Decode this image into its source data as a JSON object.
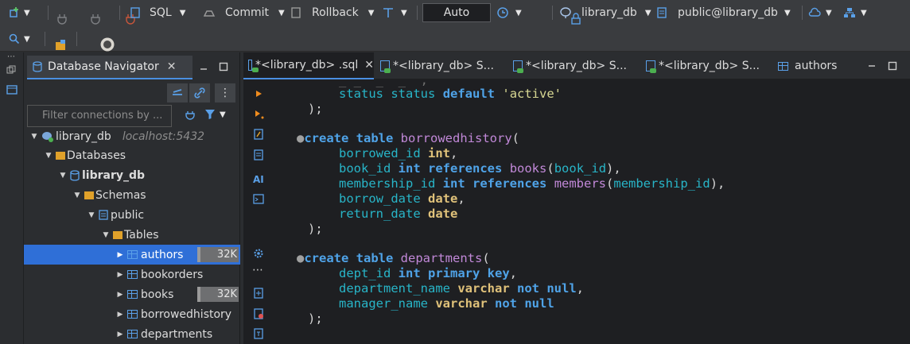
{
  "toolbar": {
    "sql_label": "SQL",
    "commit_label": "Commit",
    "rollback_label": "Rollback",
    "transaction_mode": "Auto",
    "datasource_label": "library_db",
    "schema_label": "public@library_db"
  },
  "navigator": {
    "tab_title": "Database Navigator",
    "filter_placeholder": "Filter connections by ...",
    "tree": [
      {
        "label": "library_db",
        "host": "localhost:5432"
      },
      {
        "label": "Databases"
      },
      {
        "label": "library_db"
      },
      {
        "label": "Schemas"
      },
      {
        "label": "public"
      },
      {
        "label": "Tables"
      },
      {
        "label": "authors",
        "size": "32K",
        "size_fill": 0.08
      },
      {
        "label": "bookorders"
      },
      {
        "label": "books",
        "size": "32K",
        "size_fill": 0.08
      },
      {
        "label": "borrowedhistory"
      },
      {
        "label": "departments"
      }
    ]
  },
  "editor_tabs": [
    {
      "label": "*<library_db> .sql"
    },
    {
      "label": "*<library_db> S..."
    },
    {
      "label": "*<library_db> S..."
    },
    {
      "label": "*<library_db> S..."
    },
    {
      "label": "authors"
    }
  ],
  "colors": {
    "accent": "#4a8fe2",
    "selected_row": "#2f6fd7",
    "keyword": "#4fa3e8",
    "type_keyword": "#e0c27a",
    "identifier": "#28b5c8",
    "function": "#c188d8",
    "string": "#d8d893"
  },
  "gutter_icons": [
    "run-statement-icon",
    "run-script-icon",
    "explain-plan-icon",
    "load-file-icon",
    "ai-assistant-icon",
    "console-icon",
    "settings-icon",
    "more-icon",
    "export-icon",
    "error-icon",
    "text-icon"
  ]
}
